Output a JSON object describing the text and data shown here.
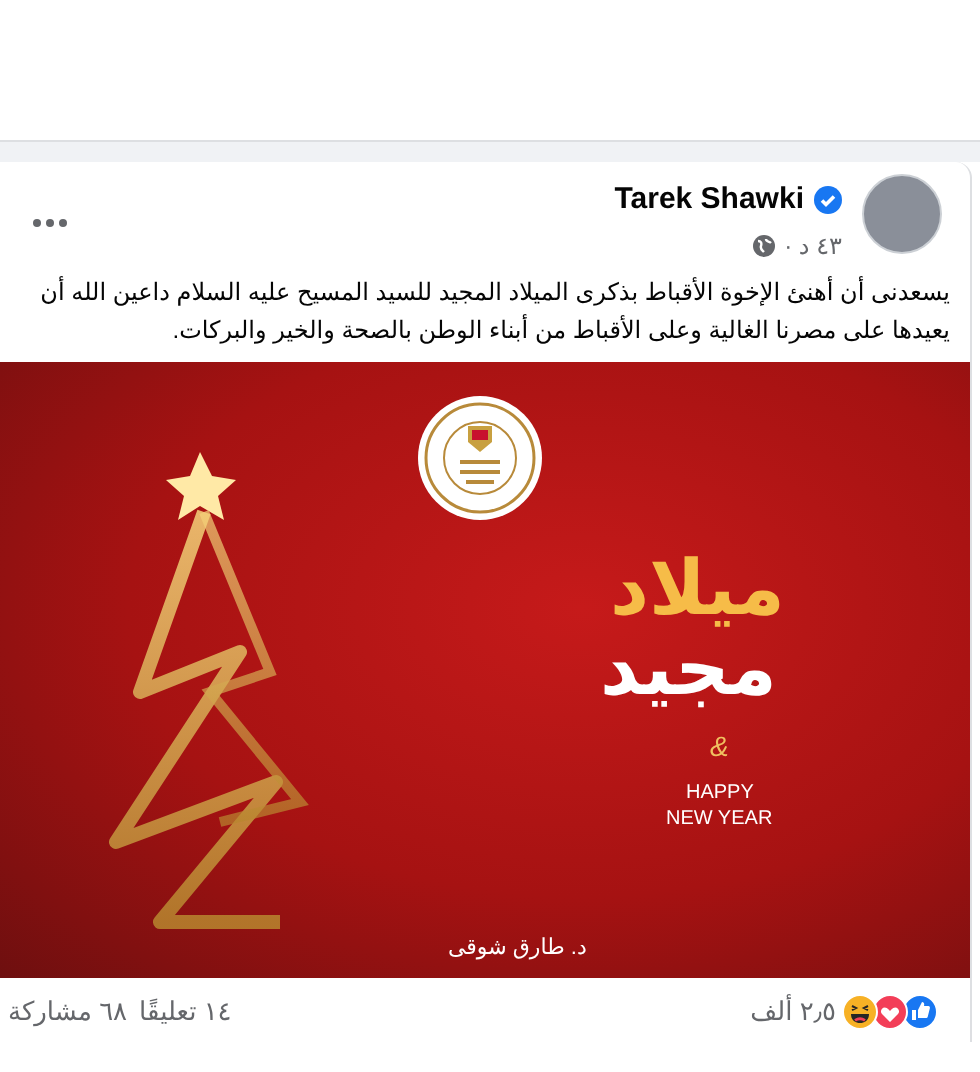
{
  "post": {
    "author": "Tarek Shawki",
    "verified": true,
    "time": "٤٣ د ·",
    "text": "يسعدنى أن أهنئ الإخوة الأقباط بذكرى الميلاد المجيد للسيد المسيح عليه السلام داعين الله أن يعيدها على مصرنا الغالية وعلى الأقباط من أبناء الوطن بالصحة والخير والبركات.",
    "image": {
      "title_line_1": "ميلاد",
      "title_line_2": "مجيد",
      "ampersand": "&",
      "greeting_line_1": "HAPPY",
      "greeting_line_2": "NEW YEAR",
      "signature": "د. طارق شوقى"
    },
    "reactions": [
      {
        "kind": "like"
      },
      {
        "kind": "love"
      },
      {
        "kind": "haha"
      }
    ],
    "reaction_count": "٢٫٥ ألف",
    "comments": "١٤ تعليقًا",
    "shares": "٦٨ مشاركة"
  }
}
